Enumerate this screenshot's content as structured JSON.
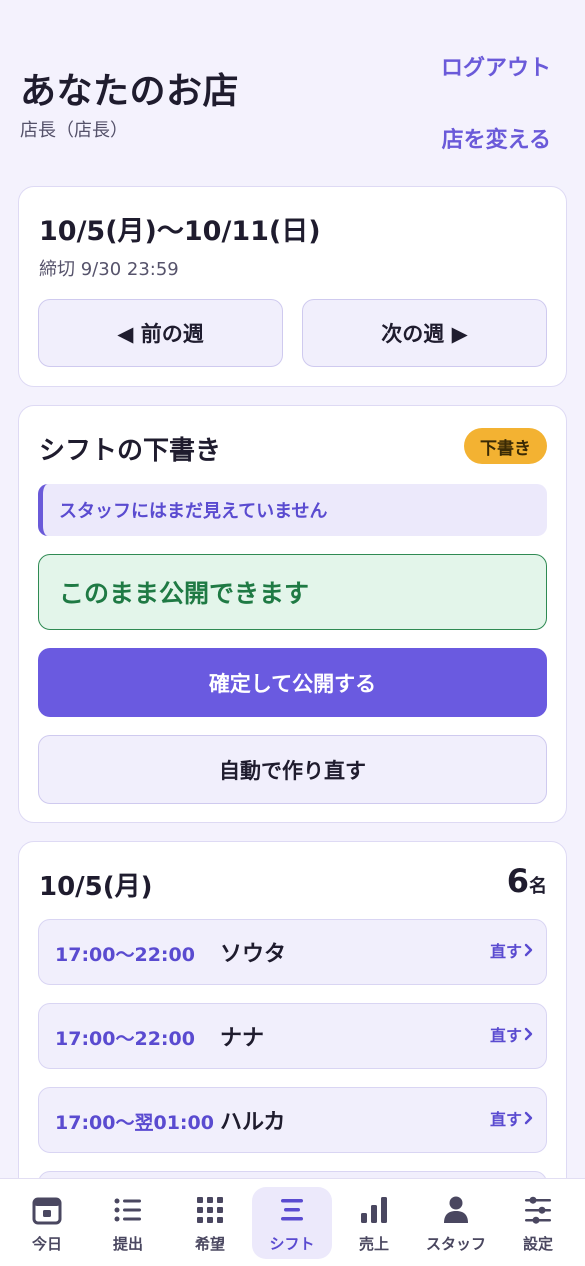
{
  "header": {
    "shop_name": "あなたのお店",
    "role": "店長（店長）",
    "logout": "ログアウト",
    "change_shop": "店を変える"
  },
  "week": {
    "range": "10/5(月)〜10/11(日)",
    "deadline": "締切 9/30 23:59",
    "prev_label": "◀ 前の週",
    "next_label": "次の週 ▶"
  },
  "draft": {
    "title": "シフトの下書き",
    "badge": "下書き",
    "notice": "スタッフにはまだ見えていません",
    "status": "このまま公開できます",
    "publish_label": "確定して公開する",
    "regenerate_label": "自動で作り直す"
  },
  "day": {
    "date": "10/5(月)",
    "count": "6",
    "count_unit": "名",
    "shifts": [
      {
        "time": "17:00〜22:00",
        "name": "ソウタ",
        "edit": "直す"
      },
      {
        "time": "17:00〜22:00",
        "name": "ナナ",
        "edit": "直す"
      },
      {
        "time": "17:00〜翌01:00",
        "name": "ハルカ",
        "edit": "直す"
      }
    ]
  },
  "nav": {
    "items": [
      {
        "label": "今日",
        "icon": "calendar-icon"
      },
      {
        "label": "提出",
        "icon": "list-icon"
      },
      {
        "label": "希望",
        "icon": "grid-icon"
      },
      {
        "label": "シフト",
        "icon": "shift-lines-icon"
      },
      {
        "label": "売上",
        "icon": "bar-chart-icon"
      },
      {
        "label": "スタッフ",
        "icon": "person-icon"
      },
      {
        "label": "設定",
        "icon": "sliders-icon"
      }
    ],
    "active_index": 3
  },
  "colors": {
    "accent": "#6a5ae0",
    "success": "#1f7a44",
    "badge": "#f3b232",
    "background": "#f4f2fd"
  }
}
